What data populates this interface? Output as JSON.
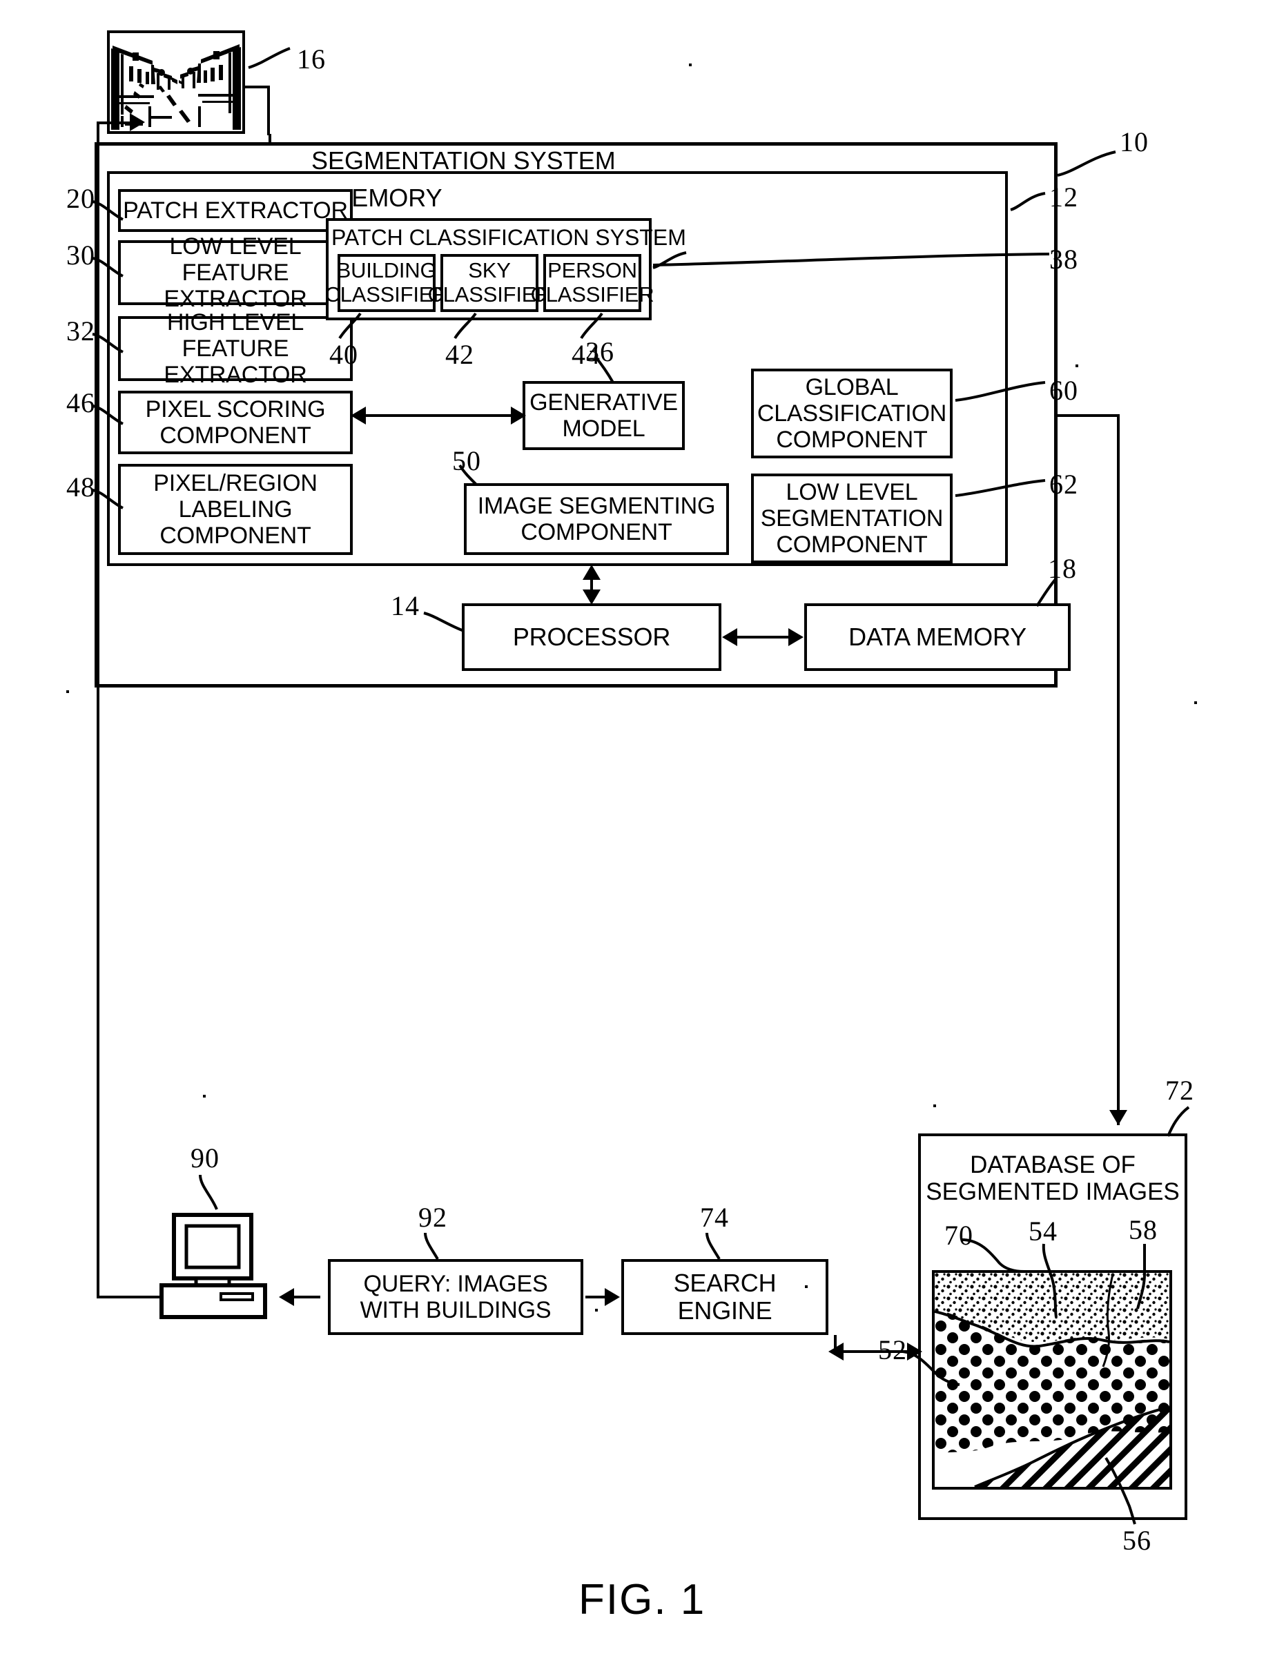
{
  "figure": {
    "caption": "FIG. 1"
  },
  "input_image": {
    "ref": "16",
    "name": "street-scene-input-image"
  },
  "segmentation_system": {
    "title": "SEGMENTATION SYSTEM",
    "ref": "10",
    "memory": {
      "title": "MEMORY",
      "ref": "12",
      "components": [
        {
          "ref": "20",
          "label": "PATCH EXTRACTOR"
        },
        {
          "ref": "30",
          "label": "LOW LEVEL\nFEATURE EXTRACTOR"
        },
        {
          "ref": "32",
          "label": "HIGH LEVEL\nFEATURE EXTRACTOR"
        },
        {
          "ref": "46",
          "label": "PIXEL SCORING\nCOMPONENT"
        },
        {
          "ref": "48",
          "label": "PIXEL/REGION\nLABELING\nCOMPONENT"
        },
        {
          "ref": "36",
          "label": "GENERATIVE\nMODEL"
        },
        {
          "ref": "50",
          "label": "IMAGE SEGMENTING\nCOMPONENT"
        },
        {
          "ref": "60",
          "label": "GLOBAL\nCLASSIFICATION\nCOMPONENT"
        },
        {
          "ref": "62",
          "label": "LOW LEVEL\nSEGMENTATION\nCOMPONENT"
        }
      ],
      "patch_classification_system": {
        "title": "PATCH CLASSIFICATION SYSTEM",
        "ref": "38",
        "classifiers": [
          {
            "ref": "40",
            "label": "BUILDING\nCLASSIFIER"
          },
          {
            "ref": "42",
            "label": "SKY\nCLASSIFIER"
          },
          {
            "ref": "44",
            "label": "PERSON\nCLASSIFIER"
          }
        ]
      }
    },
    "processor": {
      "ref": "14",
      "label": "PROCESSOR"
    },
    "data_memory": {
      "ref": "18",
      "label": "DATA MEMORY"
    }
  },
  "database": {
    "ref": "72",
    "label": "DATABASE OF\nSEGMENTED IMAGES",
    "segmented_sample": {
      "regions": [
        {
          "ref": "70",
          "name": "sky-region"
        },
        {
          "ref": "54",
          "name": "stippled-region"
        },
        {
          "ref": "58",
          "name": "right-edge-region"
        },
        {
          "ref": "52",
          "name": "dotted-building-region"
        },
        {
          "ref": "56",
          "name": "hatched-road-region"
        }
      ]
    }
  },
  "query": {
    "ref": "92",
    "label": "QUERY: IMAGES\nWITH BUILDINGS"
  },
  "search_engine": {
    "ref": "74",
    "label": "SEARCH\nENGINE"
  },
  "workstation": {
    "ref": "90",
    "name": "client-computer"
  }
}
